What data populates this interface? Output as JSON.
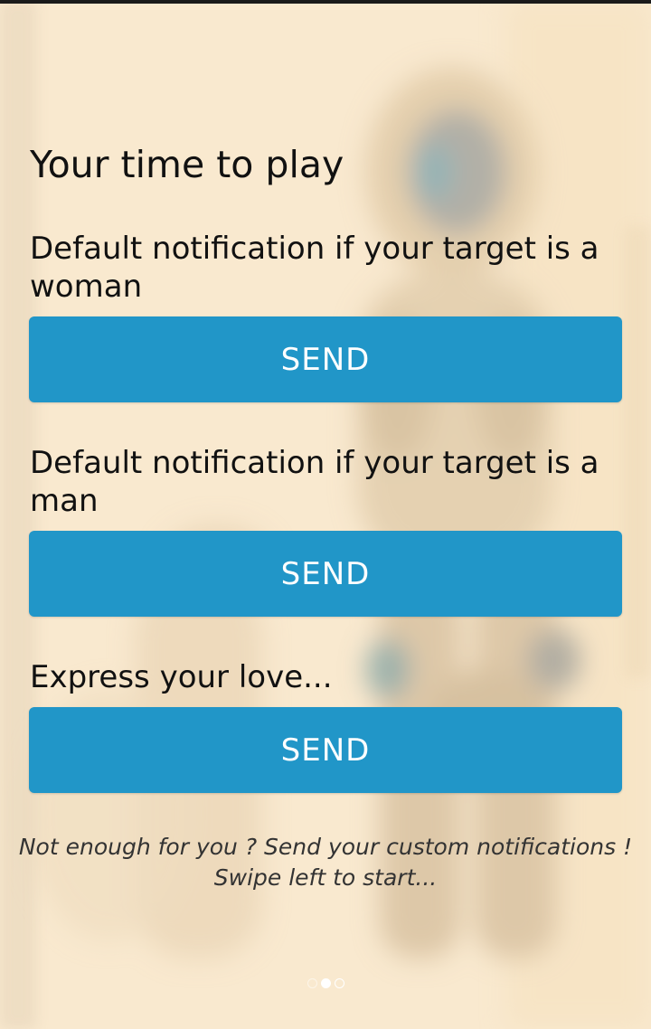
{
  "screen": {
    "heading": "Your time to play"
  },
  "sections": [
    {
      "label": "Default notification if your target is a woman",
      "button": "SEND"
    },
    {
      "label": "Default notification if your target is a man",
      "button": "SEND"
    },
    {
      "label": "Express your love...",
      "button": "SEND"
    }
  ],
  "hint": {
    "line1": "Not enough for you ? Send your custom notifications !",
    "line2": "Swipe left to start..."
  },
  "pager": {
    "page_count": 3,
    "active_index": 1
  },
  "colors": {
    "button": "#2196c8",
    "button_text": "#ffffff",
    "text": "#111111",
    "background": "#f6e4c6"
  },
  "background_image": {
    "description_icon": "blurred-figure-illustration"
  }
}
